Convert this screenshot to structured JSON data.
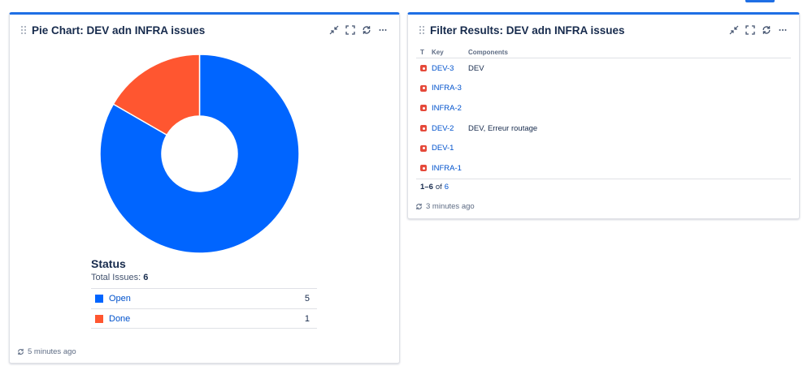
{
  "pie_gadget": {
    "title": "Pie Chart: DEV adn INFRA issues",
    "legend": {
      "title": "Status",
      "total_label": "Total Issues:",
      "total": "6",
      "rows": [
        {
          "label": "Open",
          "count": "5",
          "color": "#0065ff"
        },
        {
          "label": "Done",
          "count": "1",
          "color": "#ff5630"
        }
      ]
    },
    "refresh_text": "5 minutes ago"
  },
  "chart_data": {
    "type": "pie",
    "donut": true,
    "title": "Status",
    "categories": [
      "Open",
      "Done"
    ],
    "values": [
      5,
      1
    ],
    "colors": [
      "#0065ff",
      "#ff5630"
    ],
    "legend": "bottom"
  },
  "filter_gadget": {
    "title": "Filter Results: DEV adn INFRA issues",
    "columns": {
      "type": "T",
      "key": "Key",
      "components": "Components"
    },
    "rows": [
      {
        "key": "DEV-3",
        "components": "DEV"
      },
      {
        "key": "INFRA-3",
        "components": ""
      },
      {
        "key": "INFRA-2",
        "components": ""
      },
      {
        "key": "DEV-2",
        "components": "DEV, Erreur routage"
      },
      {
        "key": "DEV-1",
        "components": ""
      },
      {
        "key": "INFRA-1",
        "components": ""
      }
    ],
    "pagination": {
      "range": "1–6",
      "of": "of",
      "total": "6"
    },
    "refresh_text": "3 minutes ago"
  },
  "icons": {
    "actions": [
      "minimize-icon",
      "fullscreen-icon",
      "refresh-icon",
      "more-icon"
    ],
    "issue_type": "bug-icon"
  },
  "colors": {
    "accent": "#1f6fe5",
    "link": "#0052cc"
  }
}
